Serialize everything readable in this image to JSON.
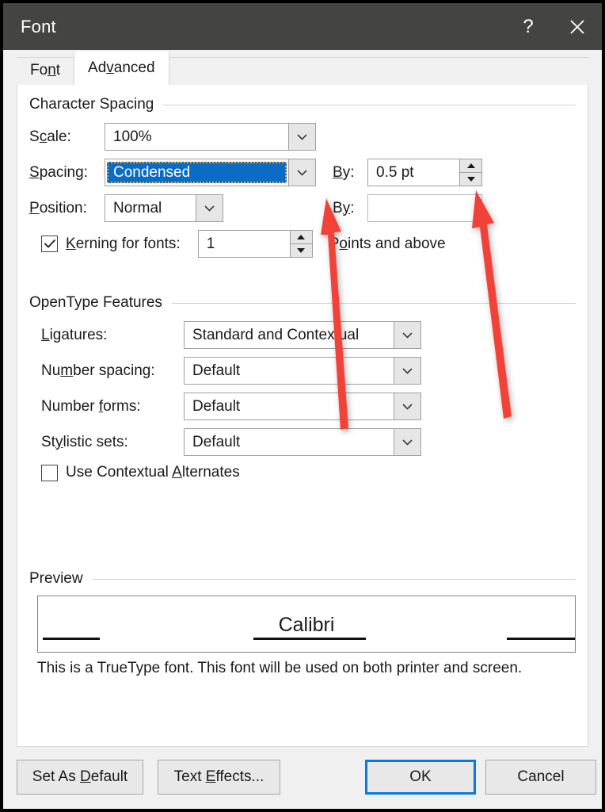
{
  "window": {
    "title": "Font",
    "help_icon": "question-mark-icon",
    "close_icon": "close-x-icon"
  },
  "tabs": [
    {
      "label": "Font",
      "accel": "n",
      "active": false
    },
    {
      "label": "Advanced",
      "accel": "v",
      "active": true
    }
  ],
  "character_spacing": {
    "group_title": "Character Spacing",
    "scale": {
      "label": "Scale:",
      "accel": "c",
      "value": "100%"
    },
    "spacing": {
      "label": "Spacing:",
      "accel": "S",
      "value": "Condensed",
      "selected": true
    },
    "spacing_by": {
      "label": "By:",
      "accel": "B",
      "value": "0.5 pt"
    },
    "position": {
      "label": "Position:",
      "accel": "P",
      "value": "Normal"
    },
    "position_by": {
      "label": "By:",
      "accel": "y",
      "value": ""
    },
    "kerning": {
      "label": "Kerning for fonts:",
      "accel": "K",
      "checked": true,
      "value": "1",
      "suffix": "Points and above",
      "suffix_accel": "o"
    }
  },
  "opentype": {
    "group_title": "OpenType Features",
    "ligatures": {
      "label": "Ligatures:",
      "accel": "L",
      "value": "Standard and Contextual"
    },
    "number_spacing": {
      "label": "Number spacing:",
      "accel": "m",
      "value": "Default"
    },
    "number_forms": {
      "label": "Number forms:",
      "accel": "f",
      "value": "Default"
    },
    "stylistic_sets": {
      "label": "Stylistic sets:",
      "accel": "y",
      "value": "Default"
    },
    "contextual_alternates": {
      "label": "Use Contextual Alternates",
      "accel": "A",
      "checked": false
    }
  },
  "preview": {
    "group_title": "Preview",
    "sample_text": "Calibri",
    "note": "This is a TrueType font. This font will be used on both printer and screen."
  },
  "footer": {
    "set_as_default": {
      "label": "Set As Default",
      "accel": "D"
    },
    "text_effects": {
      "label": "Text Effects...",
      "accel": "E"
    },
    "ok": {
      "label": "OK",
      "is_default": true
    },
    "cancel": {
      "label": "Cancel"
    }
  },
  "annotations": {
    "arrow_color": "#f04339",
    "arrows": [
      {
        "name": "arrow-to-spacing-dropdown",
        "points_to": "spacing-dropdown-button"
      },
      {
        "name": "arrow-to-spacing-by-spinner",
        "points_to": "spacing-by-spinner"
      }
    ]
  },
  "colors": {
    "titlebar": "#444442",
    "dialog_bg": "#f0f0f0",
    "panel_bg": "#ffffff",
    "selection_blue": "#0a6cc4",
    "focus_blue": "#0a7ae0",
    "annotation_red": "#f04339"
  }
}
